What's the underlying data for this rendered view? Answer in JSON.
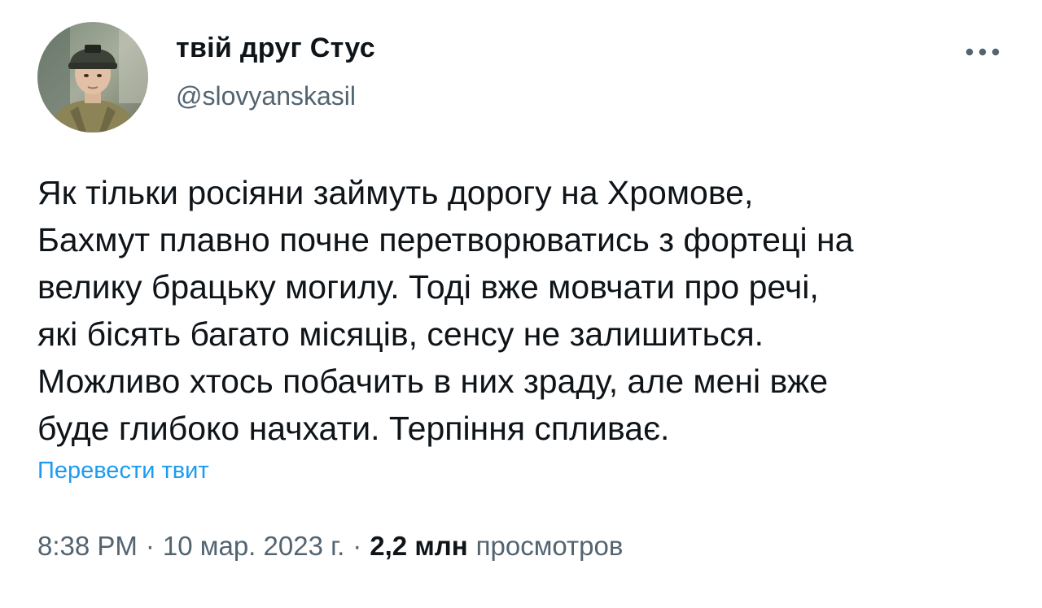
{
  "author": {
    "display_name": "твій друг Стус",
    "handle": "@slovyanskasil",
    "avatar_icon": "user-avatar-photo"
  },
  "more_icon": "more-horizontal-icon",
  "tweet": {
    "text_lines": [
      "Як тільки росіяни займуть дорогу на Хромове,",
      "Бахмут плавно почне перетворюватись з фортеці на",
      "велику брацьку могилу. Тоді вже мовчати про речі,",
      "які бісять багато місяців, сенсу не залишиться.",
      "Можливо хтось побачить в них зраду, але мені вже",
      "буде глибоко начхати. Терпіння спливає."
    ],
    "translate_label": "Перевести твит"
  },
  "meta": {
    "time": "8:38 PM",
    "separator": "·",
    "date": "10 мар. 2023 г.",
    "views_count": "2,2 млн",
    "views_label": "просмотров"
  },
  "colors": {
    "text": "#0f1419",
    "secondary": "#536471",
    "link": "#1d9bf0"
  }
}
